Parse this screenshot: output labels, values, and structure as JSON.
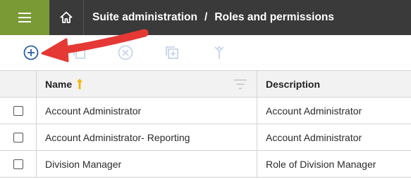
{
  "topbar": {
    "menu_icon": "hamburger-menu-icon",
    "home_icon": "home-icon",
    "breadcrumb": {
      "first": "Suite administration",
      "separator": "/",
      "second": "Roles and permissions"
    }
  },
  "toolbar": {
    "icons": [
      "add-circle-icon",
      "copy-icon",
      "delete-circle-icon",
      "add-group-icon",
      "merge-icon"
    ],
    "annotation_arrow": "red-arrow"
  },
  "table": {
    "columns": [
      "Name",
      "Description"
    ],
    "rows": [
      {
        "name": "Account Administrator",
        "description": "Account Administrator"
      },
      {
        "name": "Account Administrator- Reporting",
        "description": "Account Administrator"
      },
      {
        "name": "Division Manager",
        "description": "Role of Division Manager"
      }
    ]
  },
  "colors": {
    "menu_green": "#7a9a36",
    "topbar_dark": "#3a3a3a",
    "accent_blue": "#2a5fa8",
    "disabled_icon": "#c5d6ea",
    "arrow_red": "#e53935",
    "sort_arrow": "#f4b400"
  }
}
